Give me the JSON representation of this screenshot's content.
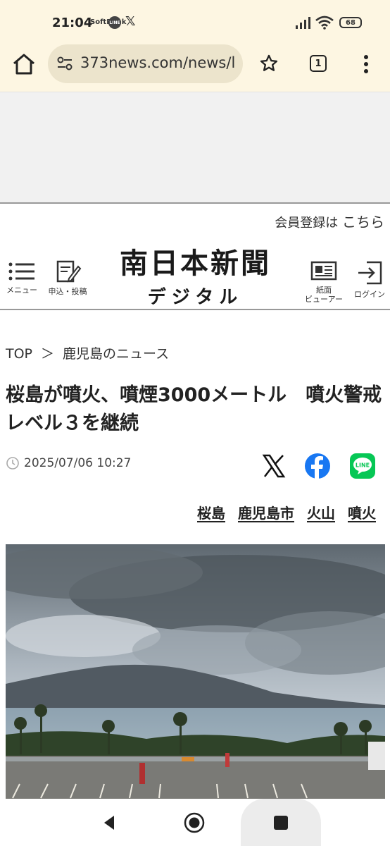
{
  "status_bar": {
    "time": "21:04",
    "notif1": "SoftBank",
    "notif2": "LINE",
    "notif3": "𝕏",
    "battery": "68"
  },
  "browser": {
    "url": "373news.com/news/l",
    "tab_count": "1"
  },
  "site_header": {
    "member_prefix": "会員登録は",
    "member_link": "こちら",
    "menu_label": "メニュー",
    "apply_label": "申込・投稿",
    "logo_line1": "南日本新聞",
    "logo_line2": "デジタル",
    "viewer_label_1": "紙面",
    "viewer_label_2": "ビューアー",
    "login_label": "ログイン"
  },
  "breadcrumb": {
    "top": "TOP",
    "separator": "＞",
    "section": "鹿児島のニュース"
  },
  "article": {
    "headline": "桜島が噴火、噴煙3000メートル　噴火警戒レベル３を継続",
    "date": "2025/07/06 10:27",
    "tags": [
      "桜島",
      "鹿児島市",
      "火山",
      "噴火"
    ]
  },
  "colors": {
    "chrome_bg": "#fdf6e2",
    "facebook": "#1877f2",
    "line": "#06c755"
  }
}
